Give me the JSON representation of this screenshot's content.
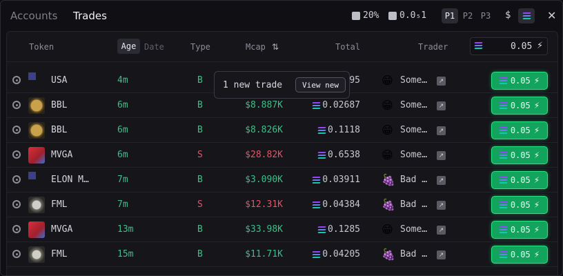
{
  "tabs": {
    "accounts": "Accounts",
    "trades": "Trades"
  },
  "toolbar": {
    "fee_label": "20%",
    "priority_label": "0.0₅1",
    "presets": [
      "P1",
      "P2",
      "P3"
    ],
    "active_preset": "P1",
    "currency_usd": "$",
    "close_icon": "✕"
  },
  "headers": {
    "token": "Token",
    "age": "Age",
    "date": "Date",
    "type": "Type",
    "mcap": "Mcap",
    "sort_icon": "⇅",
    "total": "Total",
    "trader": "Trader",
    "quick_buy_amount": "0.05"
  },
  "toast": {
    "message": "1 new trade",
    "button": "View new"
  },
  "colors": {
    "buy": "#3fbf8a",
    "sell": "#e0566a",
    "quick_buy": "#12a35c"
  },
  "rows": [
    {
      "token": "USA",
      "icon": "flag-us",
      "age": "4m",
      "type": "B",
      "mcap": "",
      "total": "95",
      "trader_emoji": "😁",
      "trader": "Some…",
      "buy": "0.05"
    },
    {
      "token": "BBL",
      "icon": "coin",
      "age": "6m",
      "type": "B",
      "mcap": "$8.887K",
      "total": "0.02687",
      "trader_emoji": "😁",
      "trader": "Some…",
      "buy": "0.05"
    },
    {
      "token": "BBL",
      "icon": "coin",
      "age": "6m",
      "type": "B",
      "mcap": "$8.826K",
      "total": "0.1118",
      "trader_emoji": "😁",
      "trader": "Some…",
      "buy": "0.05"
    },
    {
      "token": "MVGA",
      "icon": "maga",
      "age": "6m",
      "type": "S",
      "mcap": "$28.82K",
      "total": "0.6538",
      "trader_emoji": "😁",
      "trader": "Some…",
      "buy": "0.05"
    },
    {
      "token": "ELON M…",
      "icon": "flag-us",
      "age": "7m",
      "type": "B",
      "mcap": "$3.090K",
      "total": "0.03911",
      "trader_emoji": "🍇",
      "trader": "Bad …",
      "buy": "0.05"
    },
    {
      "token": "FML",
      "icon": "fml",
      "age": "7m",
      "type": "S",
      "mcap": "$12.31K",
      "total": "0.04384",
      "trader_emoji": "🍇",
      "trader": "Bad …",
      "buy": "0.05"
    },
    {
      "token": "MVGA",
      "icon": "maga",
      "age": "13m",
      "type": "B",
      "mcap": "$33.98K",
      "total": "0.1285",
      "trader_emoji": "😁",
      "trader": "Some…",
      "buy": "0.05"
    },
    {
      "token": "FML",
      "icon": "fml",
      "age": "15m",
      "type": "B",
      "mcap": "$11.71K",
      "total": "0.04205",
      "trader_emoji": "🍇",
      "trader": "Bad …",
      "buy": "0.05"
    }
  ]
}
